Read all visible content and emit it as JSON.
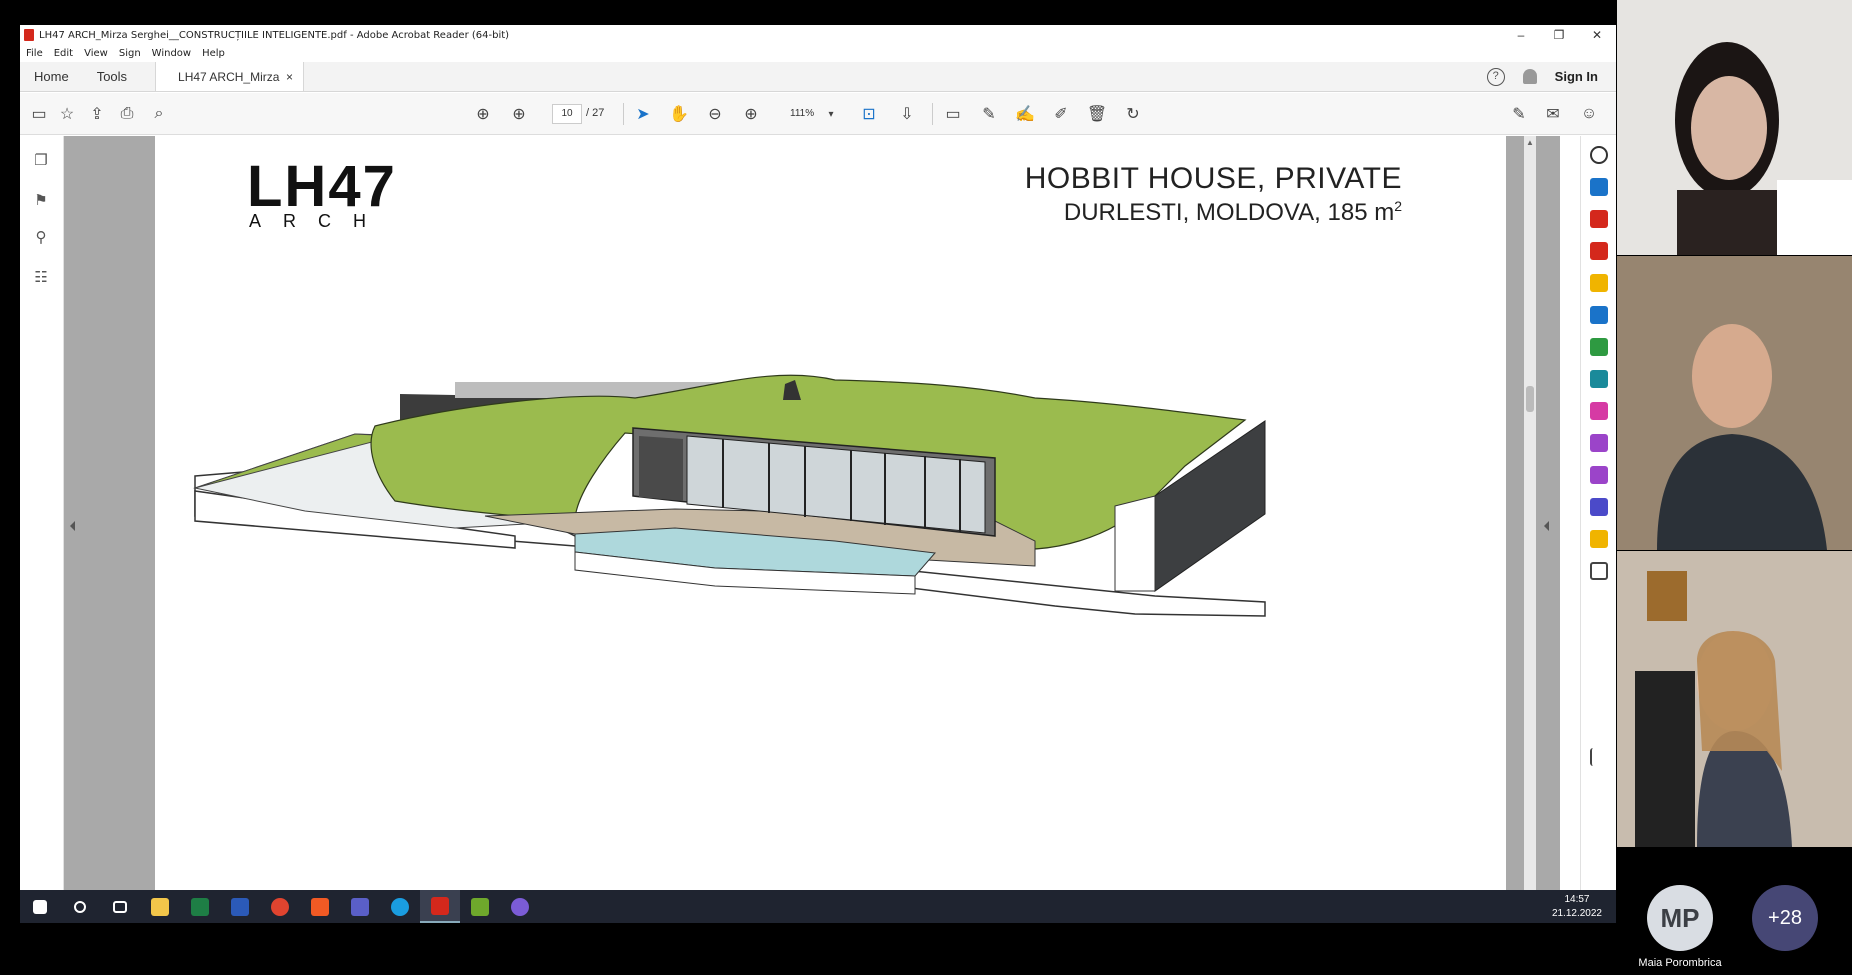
{
  "window": {
    "title": "LH47 ARCH_Mirza Serghei__CONSTRUCȚIILE INTELIGENTE.pdf - Adobe Acrobat Reader (64-bit)",
    "controls": [
      "–",
      "❐",
      "✕"
    ]
  },
  "menu": [
    "File",
    "Edit",
    "View",
    "Sign",
    "Window",
    "Help"
  ],
  "tabs": {
    "home": "Home",
    "tools": "Tools",
    "doc": "LH47 ARCH_Mirza ...",
    "close": "×",
    "sign_in": "Sign In",
    "help": "?"
  },
  "toolbar": {
    "page_current": "10",
    "page_total": "/ 27",
    "zoom": "111%"
  },
  "page": {
    "logo_main": "LH47",
    "logo_sub": "ARCH",
    "title": "HOBBIT HOUSE, PRIVATE",
    "subtitle": "DURLESTI, MOLDOVA, 185 m",
    "subtitle_sup": "2"
  },
  "taskbar": {
    "time": "14:57",
    "date": "21.12.2022"
  },
  "participants": {
    "initials": "MP",
    "name": "Maia Porombrica",
    "more": "+28"
  },
  "colors": {
    "acrobat_red": "#d4281c",
    "acrobat_blue": "#1a73c9",
    "taskbar": "#1f2430",
    "teams_more": "#464775",
    "roof_green": "#9bbb4e"
  }
}
